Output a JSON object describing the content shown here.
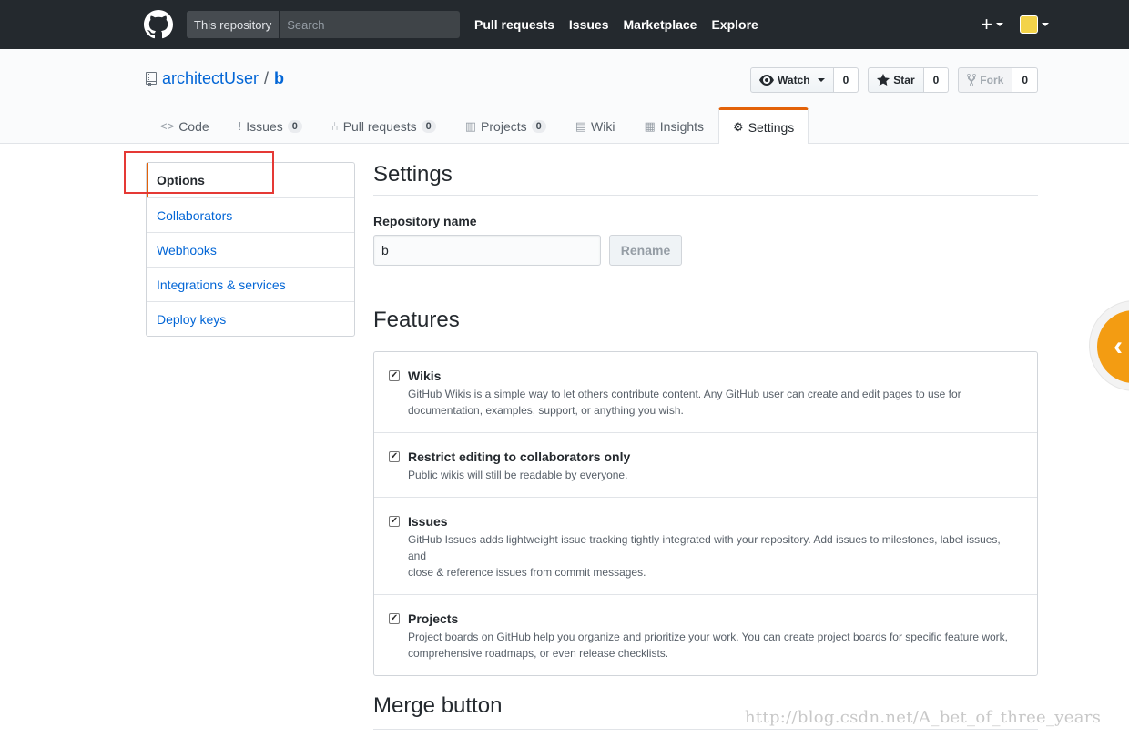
{
  "header": {
    "scope_label": "This repository",
    "search_placeholder": "Search",
    "nav": [
      "Pull requests",
      "Issues",
      "Marketplace",
      "Explore"
    ],
    "plus": "+"
  },
  "repo": {
    "owner": "architectUser",
    "separator": "/",
    "name": "b",
    "watch": {
      "label": "Watch",
      "count": "0"
    },
    "star": {
      "label": "Star",
      "count": "0"
    },
    "fork": {
      "label": "Fork",
      "count": "0"
    }
  },
  "tabs": [
    {
      "label": "Code",
      "icon": "<>"
    },
    {
      "label": "Issues",
      "count": "0",
      "icon": "!"
    },
    {
      "label": "Pull requests",
      "count": "0",
      "icon": "⑃"
    },
    {
      "label": "Projects",
      "count": "0",
      "icon": "▥"
    },
    {
      "label": "Wiki",
      "icon": "▤"
    },
    {
      "label": "Insights",
      "icon": "▦"
    },
    {
      "label": "Settings",
      "icon": "⚙"
    }
  ],
  "menu": [
    "Options",
    "Collaborators",
    "Webhooks",
    "Integrations & services",
    "Deploy keys"
  ],
  "settings": {
    "title": "Settings",
    "repo_name_label": "Repository name",
    "repo_name_value": "b",
    "rename_label": "Rename"
  },
  "features": {
    "title": "Features",
    "items": [
      {
        "name": "Wikis",
        "checked": true,
        "desc1": "GitHub Wikis is a simple way to let others contribute content. Any GitHub user can create and edit pages to use for",
        "desc2": "documentation, examples, support, or anything you wish."
      },
      {
        "name": "Restrict editing to collaborators only",
        "checked": true,
        "desc1": "Public wikis will still be readable by everyone.",
        "desc2": ""
      },
      {
        "name": "Issues",
        "checked": true,
        "desc1": "GitHub Issues adds lightweight issue tracking tightly integrated with your repository. Add issues to milestones, label issues, and",
        "desc2": "close & reference issues from commit messages."
      },
      {
        "name": "Projects",
        "checked": true,
        "desc1": "Project boards on GitHub help you organize and prioritize your work. You can create project boards for specific feature work,",
        "desc2": "comprehensive roadmaps, or even release checklists."
      }
    ]
  },
  "merge_title": "Merge button",
  "watermark": "http://blog.csdn.net/A_bet_of_three_years",
  "colors": {
    "header": "#24292e",
    "link": "#0366d6",
    "accent": "#e36209",
    "highlight_box": "#e53935"
  }
}
